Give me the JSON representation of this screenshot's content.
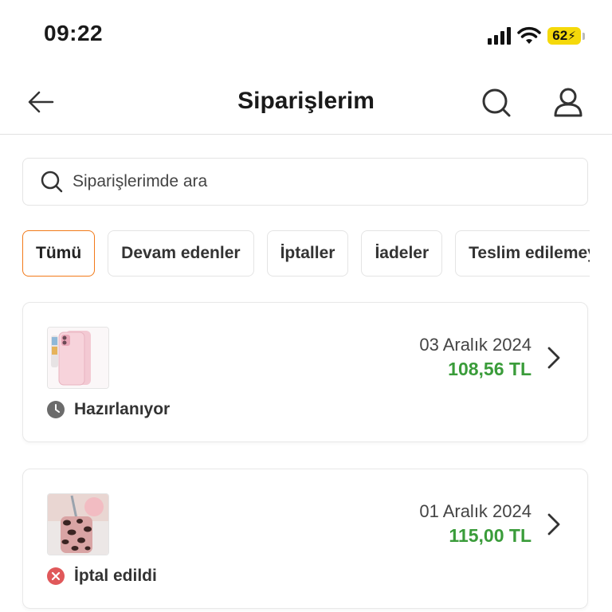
{
  "status_bar": {
    "time": "09:22",
    "battery": "62"
  },
  "header": {
    "title": "Siparişlerim"
  },
  "search": {
    "placeholder": "Siparişlerimde ara"
  },
  "filters": [
    {
      "label": "Tümü",
      "active": true
    },
    {
      "label": "Devam edenler",
      "active": false
    },
    {
      "label": "İptaller",
      "active": false
    },
    {
      "label": "İadeler",
      "active": false
    },
    {
      "label": "Teslim edilemeyenler",
      "active": false
    }
  ],
  "orders": [
    {
      "date": "03 Aralık 2024",
      "price": "108,56 TL",
      "status": "Hazırlanıyor",
      "status_icon": "clock-icon",
      "status_color": "#6b6b6b"
    },
    {
      "date": "01 Aralık 2024",
      "price": "115,00 TL",
      "status": "İptal edildi",
      "status_icon": "cancel-icon",
      "status_color": "#e0585a"
    }
  ],
  "colors": {
    "accent": "#f27a1a",
    "price": "#3a9c3a",
    "battery": "#f5d90a"
  }
}
